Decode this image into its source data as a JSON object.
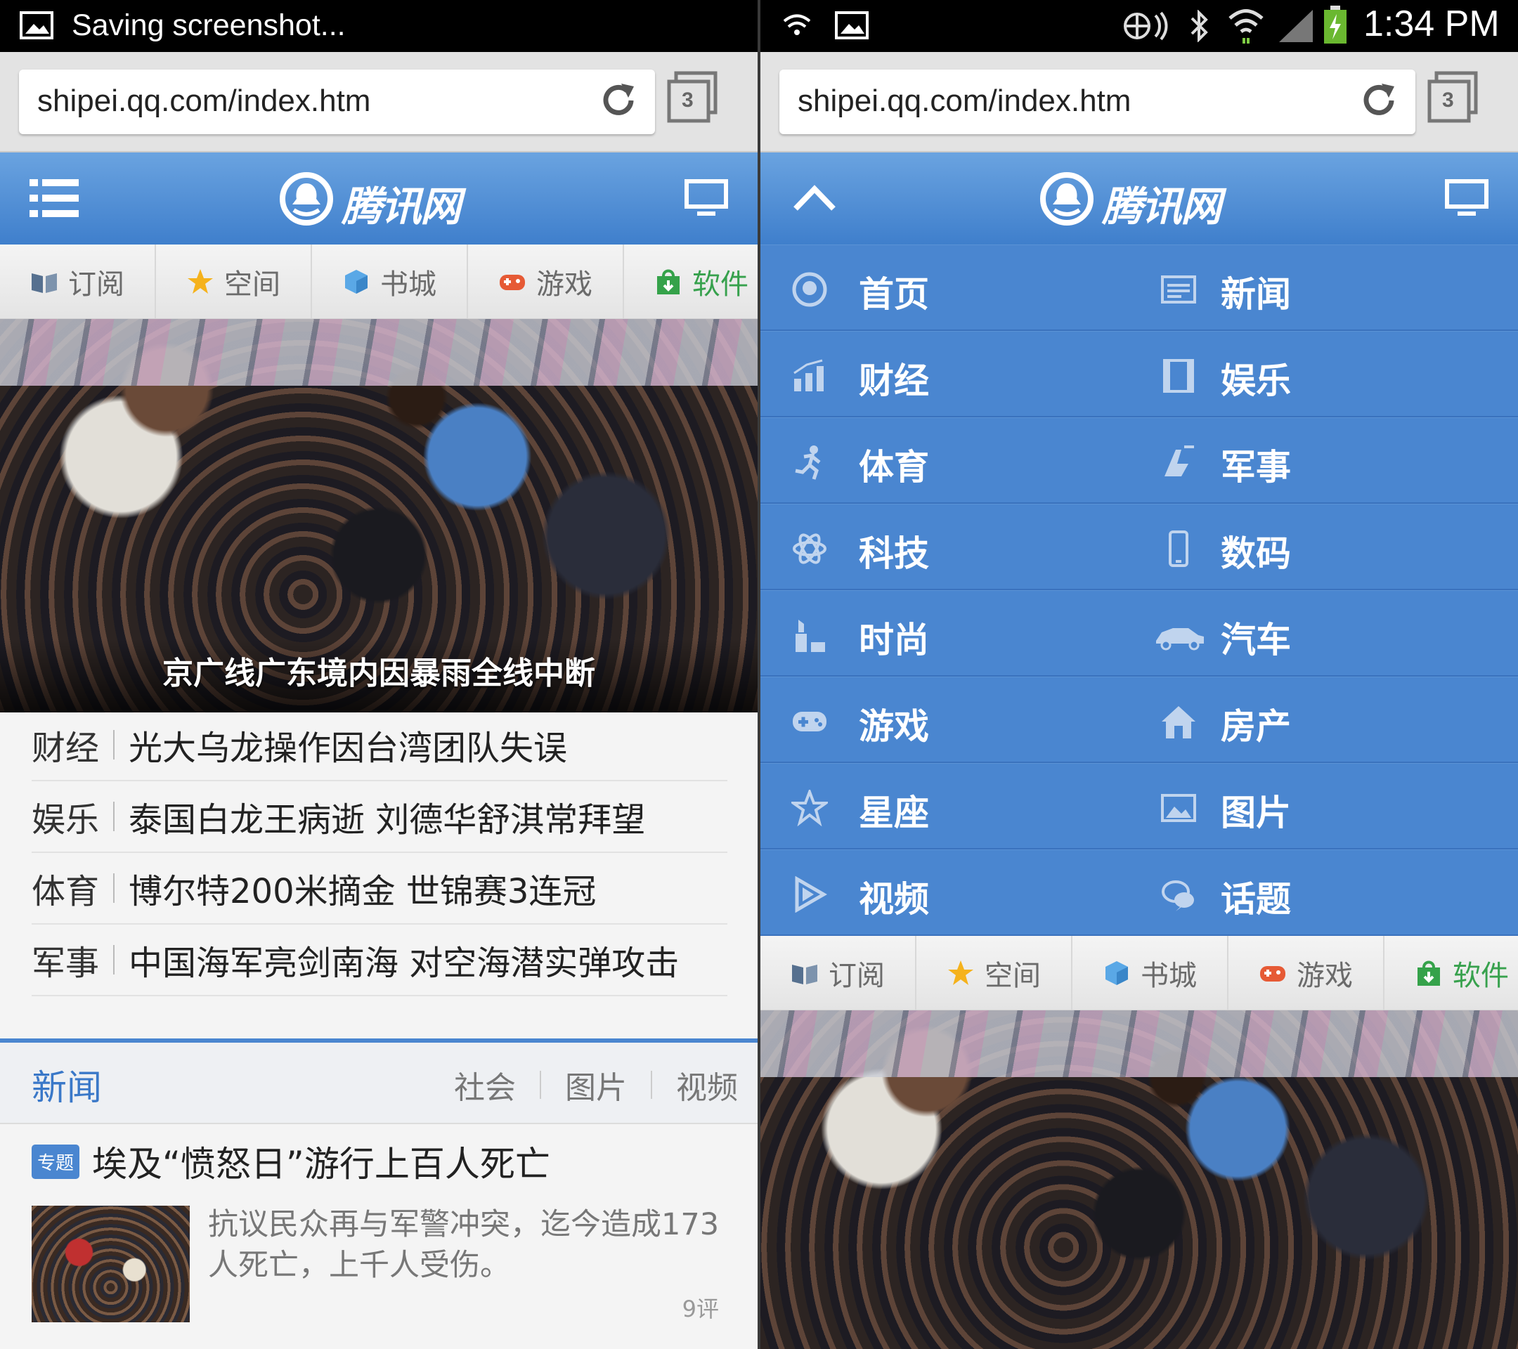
{
  "left": {
    "status": {
      "text": "Saving screenshot..."
    },
    "url": "shipei.qq.com/index.htm",
    "tab_count": "3",
    "logo": "腾讯网",
    "quicknav": [
      {
        "label": "订阅",
        "icon": "book-icon"
      },
      {
        "label": "空间",
        "icon": "star-icon"
      },
      {
        "label": "书城",
        "icon": "cube-icon"
      },
      {
        "label": "游戏",
        "icon": "gamepad-icon"
      },
      {
        "label": "软件",
        "icon": "bag-icon"
      }
    ],
    "hero_caption": "京广线广东境内因暴雨全线中断",
    "headlines": [
      {
        "category": "财经",
        "title": "光大乌龙操作因台湾团队失误"
      },
      {
        "category": "娱乐",
        "title": "泰国白龙王病逝 刘德华舒淇常拜望"
      },
      {
        "category": "体育",
        "title": "博尔特200米摘金 世锦赛3连冠"
      },
      {
        "category": "军事",
        "title": "中国海军亮剑南海 对空海潜实弹攻击"
      }
    ],
    "news_section": {
      "title": "新闻",
      "links": [
        "社会",
        "图片",
        "视频"
      ]
    },
    "topic": {
      "badge": "专题",
      "title": "埃及“愤怒日”游行上百人死亡",
      "description": "抗议民众再与军警冲突，迄今造成173人死亡，上千人受伤。",
      "comments": "9评"
    }
  },
  "right": {
    "status": {
      "time": "1:34 PM"
    },
    "url": "shipei.qq.com/index.htm",
    "tab_count": "3",
    "logo": "腾讯网",
    "menu": [
      [
        {
          "label": "首页",
          "icon": "home-icon"
        },
        {
          "label": "新闻",
          "icon": "news-icon"
        }
      ],
      [
        {
          "label": "财经",
          "icon": "finance-icon"
        },
        {
          "label": "娱乐",
          "icon": "film-icon"
        }
      ],
      [
        {
          "label": "体育",
          "icon": "runner-icon"
        },
        {
          "label": "军事",
          "icon": "military-icon"
        }
      ],
      [
        {
          "label": "科技",
          "icon": "atom-icon"
        },
        {
          "label": "数码",
          "icon": "phone-icon"
        }
      ],
      [
        {
          "label": "时尚",
          "icon": "lipstick-icon"
        },
        {
          "label": "汽车",
          "icon": "car-icon"
        }
      ],
      [
        {
          "label": "游戏",
          "icon": "gamepad-icon"
        },
        {
          "label": "房产",
          "icon": "house-icon"
        }
      ],
      [
        {
          "label": "星座",
          "icon": "star-icon"
        },
        {
          "label": "图片",
          "icon": "picture-icon"
        }
      ],
      [
        {
          "label": "视频",
          "icon": "play-icon"
        },
        {
          "label": "话题",
          "icon": "chat-icon"
        }
      ]
    ],
    "quicknav": [
      {
        "label": "订阅",
        "icon": "book-icon"
      },
      {
        "label": "空间",
        "icon": "star-icon"
      },
      {
        "label": "书城",
        "icon": "cube-icon"
      },
      {
        "label": "游戏",
        "icon": "gamepad-icon"
      },
      {
        "label": "软件",
        "icon": "bag-icon"
      }
    ]
  }
}
